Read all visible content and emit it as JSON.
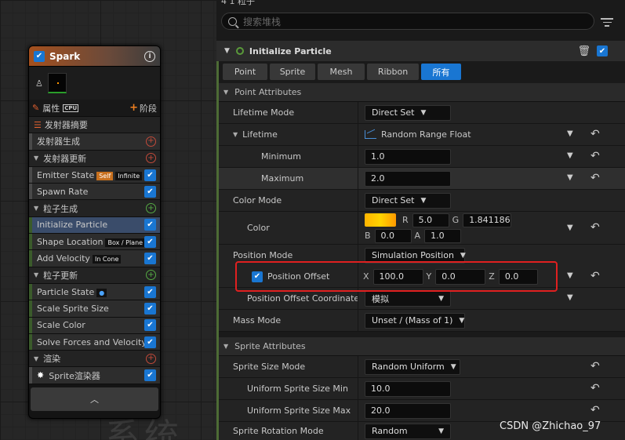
{
  "graph": {
    "background_watermark": "系统",
    "node": {
      "title": "Spark",
      "tabs": {
        "properties": "属性",
        "cpu": "CPU",
        "stage": "阶段"
      },
      "rows": [
        {
          "label": "发射器摘要",
          "kind": "summary"
        },
        {
          "label": "发射器生成",
          "kind": "item",
          "action": "add-red"
        },
        {
          "label": "发射器更新",
          "kind": "section",
          "action": "add-red"
        },
        {
          "label": "Emitter State",
          "kind": "item",
          "badges": [
            "Self",
            "Infinite"
          ],
          "checked": true
        },
        {
          "label": "Spawn Rate",
          "kind": "item",
          "checked": true
        },
        {
          "label": "粒子生成",
          "kind": "section",
          "action": "add-green"
        },
        {
          "label": "Initialize Particle",
          "kind": "item",
          "checked": true,
          "selected": true,
          "green": true
        },
        {
          "label": "Shape Location",
          "kind": "item",
          "badges": [
            "Box / Plane"
          ],
          "checked": true,
          "green": true
        },
        {
          "label": "Add Velocity",
          "kind": "item",
          "badges": [
            "In Cone"
          ],
          "checked": true,
          "green": true
        },
        {
          "label": "粒子更新",
          "kind": "section",
          "action": "add-green"
        },
        {
          "label": "Particle State",
          "kind": "item",
          "checked": true,
          "green": true
        },
        {
          "label": "Scale Sprite Size",
          "kind": "item",
          "checked": true,
          "green": true
        },
        {
          "label": "Scale Color",
          "kind": "item",
          "checked": true,
          "green": true
        },
        {
          "label": "Solve Forces and Velocity",
          "kind": "item",
          "checked": true,
          "green": true
        },
        {
          "label": "渲染",
          "kind": "section",
          "action": "add-red"
        },
        {
          "label": "Sprite渲染器",
          "kind": "renderer",
          "checked": true
        }
      ]
    }
  },
  "panel": {
    "breadcrumb": "4 1 粒子",
    "search": {
      "placeholder": "搜索堆栈"
    },
    "module": {
      "title": "Initialize Particle"
    },
    "filters": [
      {
        "label": "Point",
        "active": false
      },
      {
        "label": "Sprite",
        "active": false
      },
      {
        "label": "Mesh",
        "active": false
      },
      {
        "label": "Ribbon",
        "active": false
      },
      {
        "label": "所有",
        "active": true
      }
    ],
    "sections": {
      "point": "Point Attributes",
      "sprite": "Sprite Attributes"
    },
    "props": {
      "lifetime_mode": {
        "label": "Lifetime Mode",
        "value": "Direct Set"
      },
      "lifetime": {
        "label": "Lifetime",
        "value": "Random Range Float"
      },
      "minimum": {
        "label": "Minimum",
        "value": "1.0"
      },
      "maximum": {
        "label": "Maximum",
        "value": "2.0"
      },
      "color_mode": {
        "label": "Color Mode",
        "value": "Direct Set"
      },
      "color": {
        "label": "Color",
        "r": "5.0",
        "g": "1.841186",
        "b": "0.0",
        "a": "1.0",
        "swatch": "#ffc400"
      },
      "position_mode": {
        "label": "Position Mode",
        "value": "Simulation Position"
      },
      "position_offset": {
        "label": "Position Offset",
        "x": "100.0",
        "y": "0.0",
        "z": "0.0"
      },
      "position_offset_coord": {
        "label": "Position Offset Coordinate",
        "value": "模拟"
      },
      "mass_mode": {
        "label": "Mass Mode",
        "value": "Unset / (Mass of 1)"
      },
      "sprite_size_mode": {
        "label": "Sprite Size Mode",
        "value": "Random Uniform"
      },
      "sprite_size_min": {
        "label": "Uniform Sprite Size Min",
        "value": "10.0"
      },
      "sprite_size_max": {
        "label": "Uniform Sprite Size Max",
        "value": "20.0"
      },
      "sprite_rotation_mode": {
        "label": "Sprite Rotation Mode",
        "value": "Random"
      }
    },
    "axes": {
      "r": "R",
      "g": "G",
      "b": "B",
      "a": "A",
      "x": "X",
      "y": "Y",
      "z": "Z"
    }
  },
  "credit": "CSDN @Zhichao_97",
  "colors": {
    "accent": "#1976d2",
    "highlight": "#e02020"
  }
}
